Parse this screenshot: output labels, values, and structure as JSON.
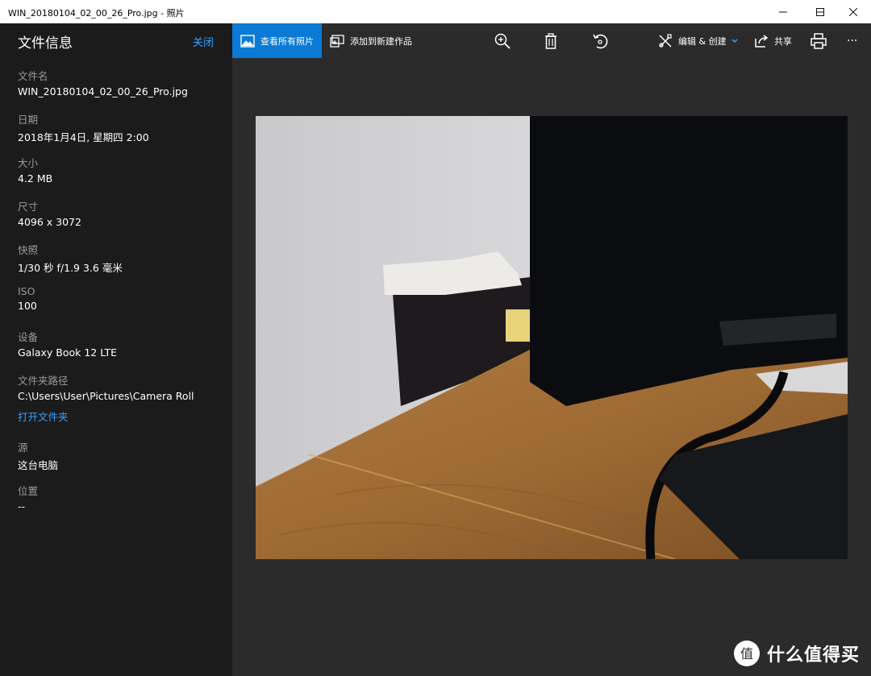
{
  "window": {
    "title": "WIN_20180104_02_00_26_Pro.jpg - 照片",
    "controls": {
      "minimize": "—",
      "maximize": "☐",
      "close": "✕"
    }
  },
  "sidebar": {
    "title": "文件信息",
    "close_label": "关闭",
    "fields": [
      {
        "label": "文件名",
        "value": "WIN_20180104_02_00_26_Pro.jpg"
      },
      {
        "label": "日期",
        "value": "2018年1月4日, 星期四 2:00"
      },
      {
        "label": "大小",
        "value": "4.2 MB"
      },
      {
        "label": "尺寸",
        "value": "4096 x 3072"
      },
      {
        "label": "快照",
        "value": "1/30 秒 f/1.9 3.6 毫米"
      },
      {
        "label": "ISO",
        "value": "100"
      },
      {
        "label": "设备",
        "value": "Galaxy Book 12 LTE"
      },
      {
        "label": "文件夹路径",
        "value": "C:\\Users\\User\\Pictures\\Camera Roll",
        "link": "打开文件夹"
      },
      {
        "label": "源",
        "value": "这台电脑"
      },
      {
        "label": "位置",
        "value": "--"
      }
    ]
  },
  "toolbar": {
    "view_all_label": "查看所有照片",
    "add_to_creation_label": "添加到新建作品",
    "edit_create_label": "编辑 & 创建",
    "share_label": "共享",
    "icons": [
      "zoom-icon",
      "delete-icon",
      "rotate-icon",
      "edit-icon",
      "share-icon",
      "print-icon",
      "more-icon"
    ],
    "more_label": "···"
  },
  "watermark": {
    "text": "什么值得买",
    "logo_glyph": "值"
  },
  "colors": {
    "accent": "#0a7ad6",
    "link": "#3aa0ff",
    "sidebar_bg": "#1b1b1b",
    "viewer_bg": "#2b2b2b"
  }
}
